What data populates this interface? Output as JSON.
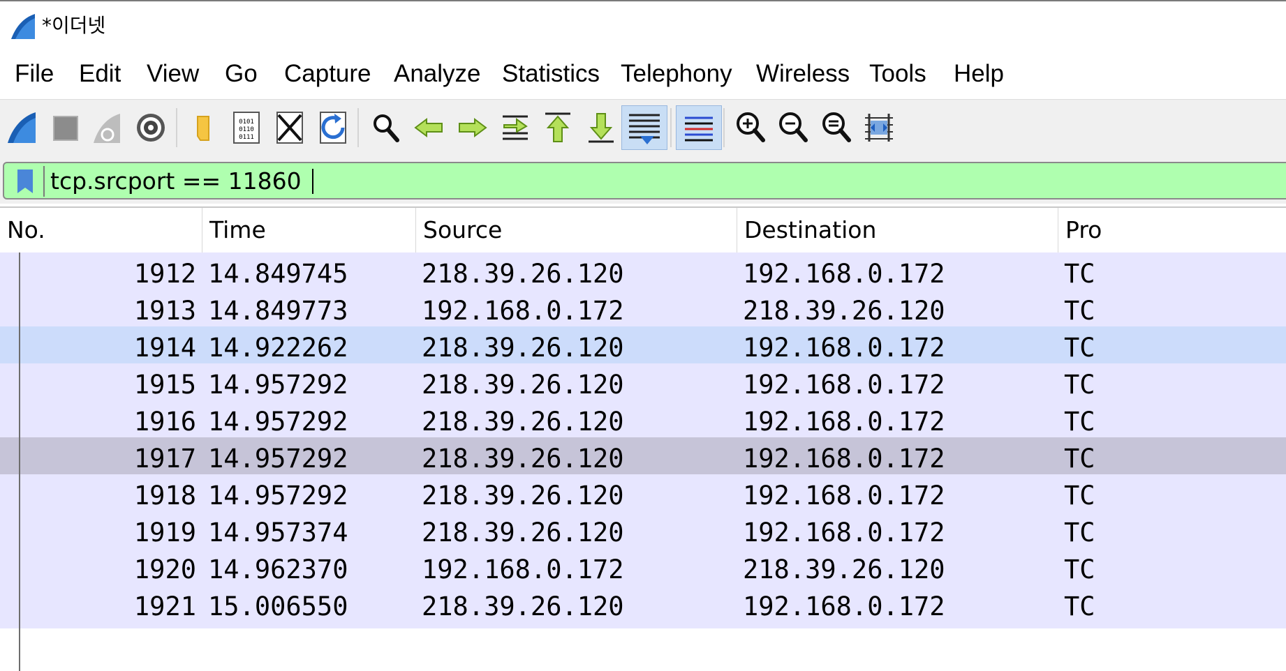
{
  "window": {
    "title": "*이더넷",
    "app_icon": "wireshark-fin-icon"
  },
  "menubar": {
    "items": [
      "File",
      "Edit",
      "View",
      "Go",
      "Capture",
      "Analyze",
      "Statistics",
      "Telephony",
      "Wireless",
      "Tools",
      "Help"
    ]
  },
  "toolbar": {
    "buttons": [
      {
        "icon": "start-capture-icon"
      },
      {
        "icon": "stop-capture-icon"
      },
      {
        "icon": "restart-capture-icon"
      },
      {
        "icon": "capture-options-icon"
      },
      {
        "icon": "open-file-icon"
      },
      {
        "icon": "save-file-icon"
      },
      {
        "icon": "close-file-icon"
      },
      {
        "icon": "reload-file-icon"
      },
      {
        "icon": "find-packet-icon"
      },
      {
        "icon": "go-back-icon"
      },
      {
        "icon": "go-forward-icon"
      },
      {
        "icon": "go-to-packet-icon"
      },
      {
        "icon": "go-first-packet-icon"
      },
      {
        "icon": "go-last-packet-icon"
      },
      {
        "icon": "auto-scroll-icon",
        "active": true
      },
      {
        "icon": "colorize-icon",
        "active": true
      },
      {
        "icon": "zoom-in-icon"
      },
      {
        "icon": "zoom-out-icon"
      },
      {
        "icon": "normal-size-icon"
      },
      {
        "icon": "resize-columns-icon"
      }
    ]
  },
  "filter": {
    "value": "tcp.srcport == 11860",
    "bookmark_icon": "bookmark-icon",
    "background": "#afffaf"
  },
  "packet_list": {
    "columns": [
      "No.",
      "Time",
      "Source",
      "Destination",
      "Pro"
    ],
    "rows": [
      {
        "no": "1912",
        "time": "14.849745",
        "source": "218.39.26.120",
        "destination": "192.168.0.172",
        "protocol": "TC",
        "bg": "#e7e6ff"
      },
      {
        "no": "1913",
        "time": "14.849773",
        "source": "192.168.0.172",
        "destination": "218.39.26.120",
        "protocol": "TC",
        "bg": "#e7e6ff"
      },
      {
        "no": "1914",
        "time": "14.922262",
        "source": "218.39.26.120",
        "destination": "192.168.0.172",
        "protocol": "TC",
        "bg": "#ccdcfb"
      },
      {
        "no": "1915",
        "time": "14.957292",
        "source": "218.39.26.120",
        "destination": "192.168.0.172",
        "protocol": "TC",
        "bg": "#e7e6ff"
      },
      {
        "no": "1916",
        "time": "14.957292",
        "source": "218.39.26.120",
        "destination": "192.168.0.172",
        "protocol": "TC",
        "bg": "#e7e6ff"
      },
      {
        "no": "1917",
        "time": "14.957292",
        "source": "218.39.26.120",
        "destination": "192.168.0.172",
        "protocol": "TC",
        "bg": "#c6c4d8"
      },
      {
        "no": "1918",
        "time": "14.957292",
        "source": "218.39.26.120",
        "destination": "192.168.0.172",
        "protocol": "TC",
        "bg": "#e7e6ff"
      },
      {
        "no": "1919",
        "time": "14.957374",
        "source": "218.39.26.120",
        "destination": "192.168.0.172",
        "protocol": "TC",
        "bg": "#e7e6ff"
      },
      {
        "no": "1920",
        "time": "14.962370",
        "source": "192.168.0.172",
        "destination": "218.39.26.120",
        "protocol": "TC",
        "bg": "#e7e6ff"
      },
      {
        "no": "1921",
        "time": "15.006550",
        "source": "218.39.26.120",
        "destination": "192.168.0.172",
        "protocol": "TC",
        "bg": "#e7e6ff"
      }
    ]
  }
}
